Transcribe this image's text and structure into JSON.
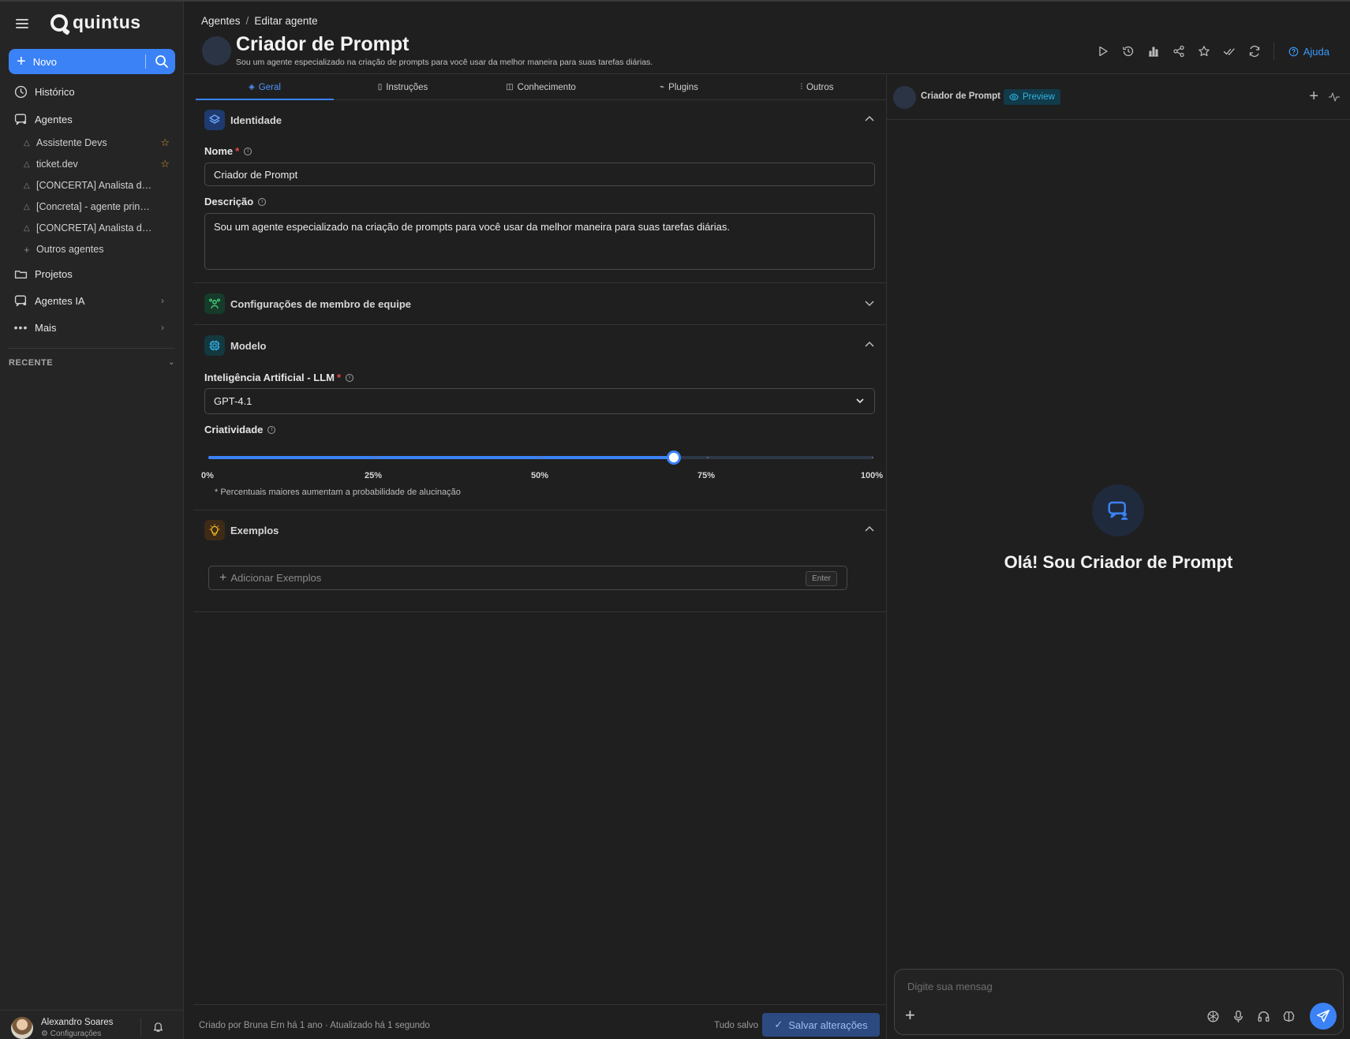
{
  "app": {
    "logo": "quintus"
  },
  "sidebar": {
    "new_label": "Novo",
    "nav": {
      "historico": "Histórico",
      "agentes": "Agentes",
      "projetos": "Projetos",
      "agentes_ia": "Agentes IA",
      "mais": "Mais"
    },
    "agents": [
      {
        "label": "Assistente Devs",
        "starred": true
      },
      {
        "label": "ticket.dev",
        "starred": true
      },
      {
        "label": "[CONCERTA] Analista de...",
        "starred": false
      },
      {
        "label": "[Concreta] - agente principal",
        "starred": false
      },
      {
        "label": "[CONCRETA] Analista de...",
        "starred": false
      }
    ],
    "other_agents": "Outros agentes",
    "recent_label": "RECENTE",
    "user": {
      "name": "Alexandro Soares",
      "sub": "Configurações"
    }
  },
  "header": {
    "breadcrumb": [
      "Agentes",
      "Editar agente"
    ],
    "title": "Criador de Prompt",
    "description": "Sou um agente especializado na criação de prompts para você usar da melhor maneira para suas tarefas diárias.",
    "tools": [
      "play-icon",
      "history-icon",
      "chart-icon",
      "share-icon",
      "star-icon",
      "check-double-icon",
      "refresh-icon"
    ],
    "help_label": "Ajuda"
  },
  "tabs": [
    {
      "label": "Geral",
      "icon": "layers-icon",
      "active": true
    },
    {
      "label": "Instruções",
      "icon": "document-icon",
      "active": false
    },
    {
      "label": "Conhecimento",
      "icon": "book-icon",
      "active": false
    },
    {
      "label": "Plugins",
      "icon": "plug-icon",
      "active": false
    },
    {
      "label": "Outros",
      "icon": "sliders-icon",
      "active": false
    }
  ],
  "form": {
    "identidade": {
      "title": "Identidade",
      "name_label": "Nome",
      "name_value": "Criador de Prompt",
      "desc_label": "Descrição",
      "desc_value": "Sou um agente especializado na criação de prompts para você usar da melhor maneira para suas tarefas diárias."
    },
    "equipe": {
      "title": "Configurações de membro de equipe"
    },
    "modelo": {
      "title": "Modelo",
      "llm_label": "Inteligência Artificial - LLM",
      "llm_value": "GPT-4.1",
      "creativity_label": "Criatividade",
      "creativity_value": 0.7,
      "scale": [
        "0%",
        "25%",
        "50%",
        "75%",
        "100%"
      ],
      "hint": "* Percentuais maiores aumentam a probabilidade de alucinação"
    },
    "exemplos": {
      "title": "Exemplos",
      "placeholder": "Adicionar Exemplos",
      "enter_key": "Enter"
    }
  },
  "footer": {
    "meta": "Criado por Bruna Ern há 1 ano · Atualizado há 1 segundo",
    "status": "Tudo salvo",
    "save_label": "Salvar alterações"
  },
  "preview": {
    "name": "Criador de Prompt",
    "badge": "Preview",
    "greeting": "Olá! Sou Criador de Prompt",
    "chat_placeholder": "Digite sua mensag",
    "tools": [
      "openai-icon",
      "mic-icon",
      "headset-icon",
      "brain-icon"
    ]
  },
  "colors": {
    "accent": "#3b82f6",
    "star": "#d99a3a",
    "required": "#ef4444",
    "preview_badge": "#34b3e0"
  }
}
